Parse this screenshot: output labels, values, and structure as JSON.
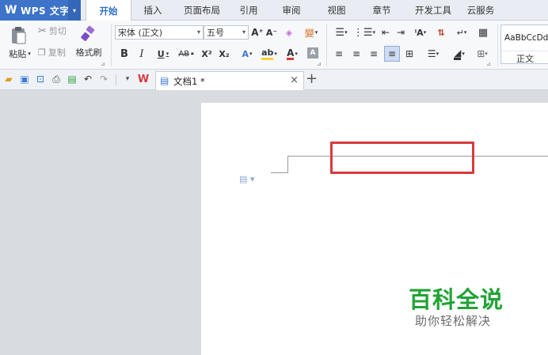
{
  "app": {
    "logo": "W",
    "title": "WPS 文字",
    "dropdown_glyph": "▾"
  },
  "menu": {
    "tabs": [
      {
        "label": "开始",
        "active": true
      },
      {
        "label": "插入"
      },
      {
        "label": "页面布局"
      },
      {
        "label": "引用"
      },
      {
        "label": "审阅"
      },
      {
        "label": "视图"
      },
      {
        "label": "章节"
      },
      {
        "label": "开发工具"
      },
      {
        "label": "云服务"
      }
    ]
  },
  "ribbon": {
    "paste_label": "粘贴",
    "cut_label": "剪切",
    "copy_label": "复制",
    "format_painter_label": "格式刷",
    "font_name": "宋体 (正文)",
    "font_size": "五号",
    "grow_font": "A⁺",
    "shrink_font": "A⁻",
    "bold": "B",
    "italic": "I",
    "underline": "U",
    "strikethrough": "AB",
    "superscript": "X²",
    "subscript": "X₂",
    "style_preview": "AaBbCcDd",
    "style_name": "正文",
    "accent_color": "#2c6ecb",
    "font_color": "#d9393d",
    "highlight_color": "#f2d23a"
  },
  "tabbar": {
    "doc_tab_label": "文档1 *",
    "close_glyph": "×",
    "add_glyph": "+"
  },
  "watermark": {
    "main": "百科全说",
    "sub": "助你轻松解决",
    "color": "#21a336"
  }
}
